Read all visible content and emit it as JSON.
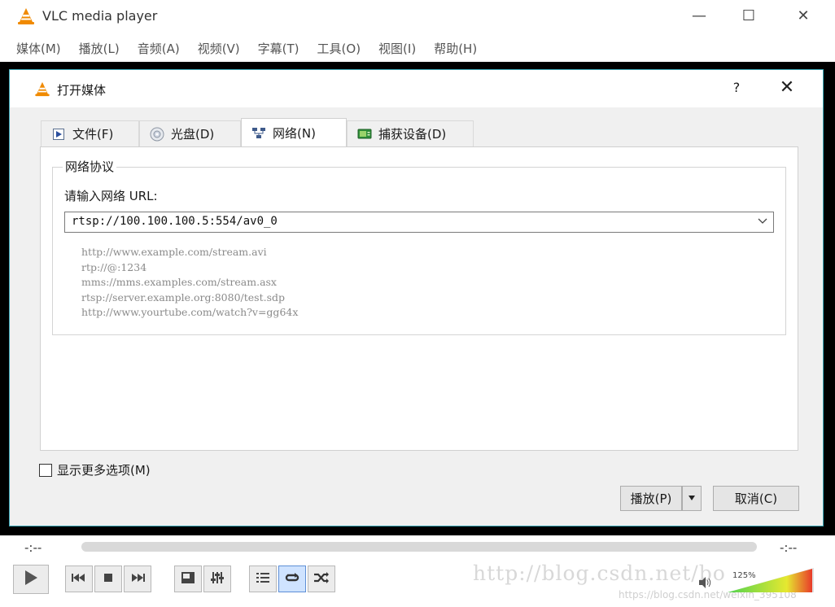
{
  "window": {
    "title": "VLC media player",
    "minimize": "—",
    "maximize": "☐",
    "close": "✕"
  },
  "menu": [
    "媒体(M)",
    "播放(L)",
    "音频(A)",
    "视频(V)",
    "字幕(T)",
    "工具(O)",
    "视图(I)",
    "帮助(H)"
  ],
  "dialog": {
    "title": "打开媒体",
    "help": "?",
    "close": "✕",
    "tabs": [
      {
        "label": "文件(F)",
        "icon": "file-icon"
      },
      {
        "label": "光盘(D)",
        "icon": "disc-icon"
      },
      {
        "label": "网络(N)",
        "icon": "network-icon",
        "active": true
      },
      {
        "label": "捕获设备(D)",
        "icon": "capture-device-icon"
      }
    ],
    "group_title": "网络协议",
    "url_label": "请输入网络 URL:",
    "url_value": "rtsp://100.100.100.5:554/av0_0",
    "examples": [
      "http://www.example.com/stream.avi",
      "rtp://@:1234",
      "mms://mms.examples.com/stream.asx",
      "rtsp://server.example.org:8080/test.sdp",
      "http://www.yourtube.com/watch?v=gg64x"
    ],
    "more_options": "显示更多选项(M)",
    "play_label": "播放(P)",
    "cancel_label": "取消(C)"
  },
  "player": {
    "time_elapsed": "-:--",
    "time_total": "-:--",
    "volume_label": "125%",
    "volume_level": 1.25,
    "watermark": "http://blog.csdn.net/bo",
    "watermark2": "https://blog.csdn.net/weixin_395108"
  },
  "colors": {
    "accent_border": "#3aa6b5",
    "video_bg": "#000000",
    "vlc_orange": "#f08a00"
  }
}
